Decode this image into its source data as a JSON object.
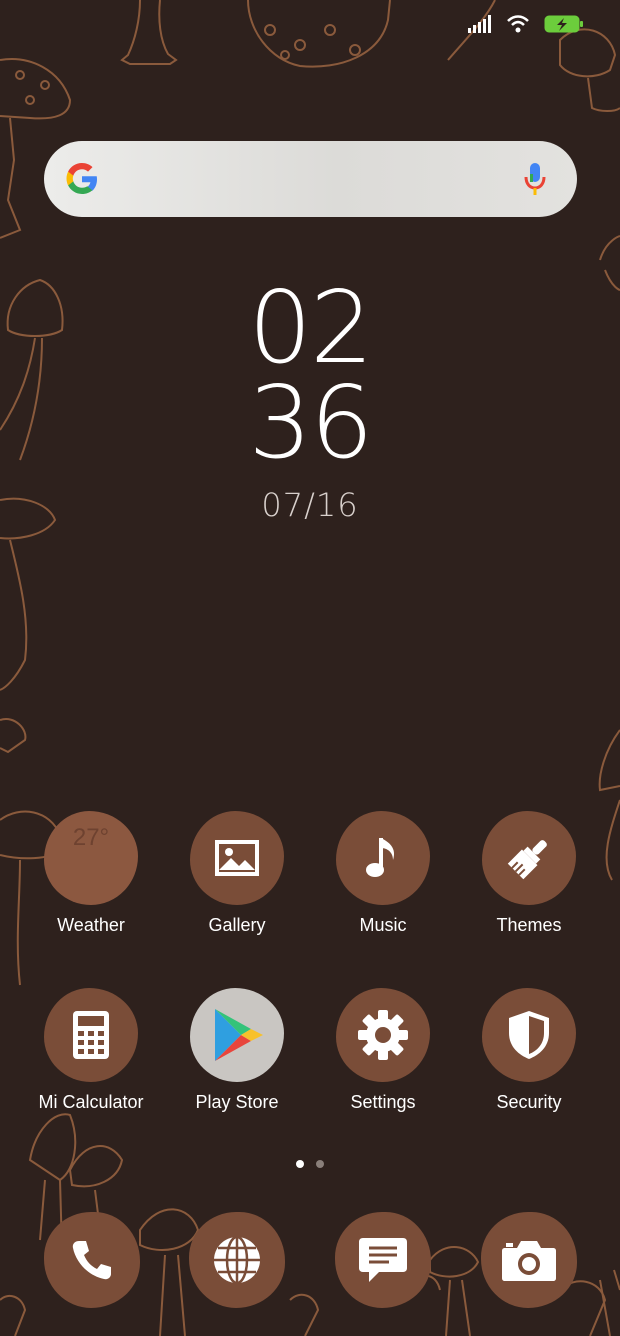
{
  "status_bar": {
    "signal_icon": "signal-bars-icon",
    "wifi_icon": "wifi-icon",
    "battery_icon": "battery-charging-icon",
    "battery_color": "#6ccd3c"
  },
  "search_bar": {
    "logo_icon": "google-g-icon",
    "mic_icon": "microphone-icon"
  },
  "clock": {
    "hours": "02",
    "minutes": "36",
    "date": "07/16"
  },
  "home_apps": [
    {
      "label": "Weather",
      "icon": "weather-icon",
      "badge": "27°"
    },
    {
      "label": "Gallery",
      "icon": "gallery-icon"
    },
    {
      "label": "Music",
      "icon": "music-note-icon"
    },
    {
      "label": "Themes",
      "icon": "paintbrush-icon"
    },
    {
      "label": "Mi Calculator",
      "icon": "calculator-icon"
    },
    {
      "label": "Play Store",
      "icon": "play-store-icon"
    },
    {
      "label": "Settings",
      "icon": "gear-icon"
    },
    {
      "label": "Security",
      "icon": "shield-icon"
    }
  ],
  "page_indicator": {
    "pages": 2,
    "current": 1
  },
  "dock": [
    {
      "icon": "phone-icon"
    },
    {
      "icon": "browser-globe-icon"
    },
    {
      "icon": "messages-icon"
    },
    {
      "icon": "camera-icon"
    }
  ],
  "colors": {
    "background": "#2e211d",
    "icon_bg": "#7a4d38",
    "line_art": "#8a5a3c"
  }
}
